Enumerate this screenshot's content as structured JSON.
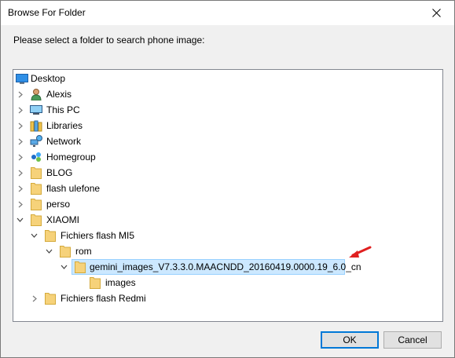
{
  "window": {
    "title": "Browse For Folder"
  },
  "prompt": "Please select a folder to search phone image:",
  "tree": {
    "desktop": "Desktop",
    "alexis": "Alexis",
    "this_pc": "This PC",
    "libraries": "Libraries",
    "network": "Network",
    "homegroup": "Homegroup",
    "blog": "BLOG",
    "flash_ulefone": "flash ulefone",
    "perso": "perso",
    "xiaomi": "XIAOMI",
    "fichiers_flash_mi5": "Fichiers flash MI5",
    "rom": "rom",
    "selected_folder": "gemini_images_V7.3.3.0.MAACNDD_20160419.0000.19_6.0_cn",
    "images": "images",
    "fichiers_flash_redmi": "Fichiers flash Redmi"
  },
  "buttons": {
    "ok": "OK",
    "cancel": "Cancel"
  },
  "colors": {
    "selection": "#cce8ff",
    "folder": "#f6d27a",
    "annotation_arrow": "#e02020"
  }
}
